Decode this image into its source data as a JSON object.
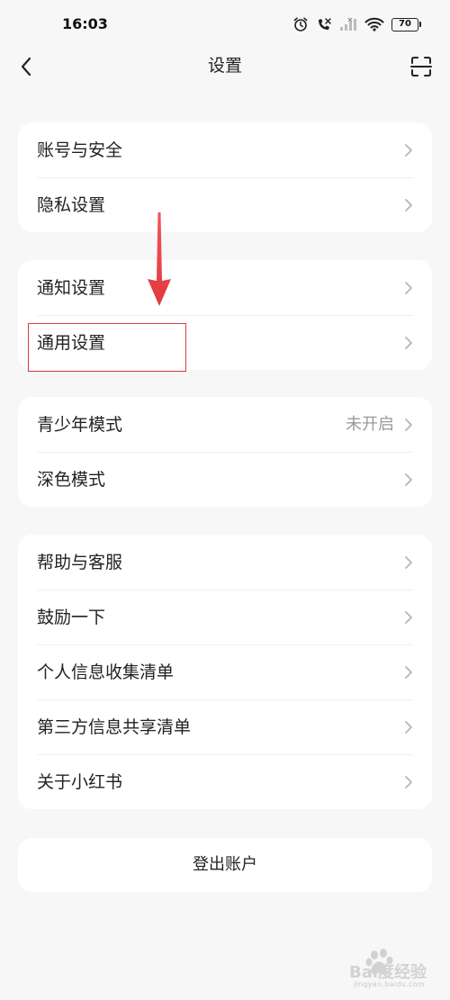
{
  "status_bar": {
    "time": "16:03",
    "battery": "70"
  },
  "header": {
    "title": "设置"
  },
  "groups": [
    {
      "items": [
        {
          "label": "账号与安全",
          "value": ""
        },
        {
          "label": "隐私设置",
          "value": ""
        }
      ]
    },
    {
      "items": [
        {
          "label": "通知设置",
          "value": ""
        },
        {
          "label": "通用设置",
          "value": ""
        }
      ]
    },
    {
      "items": [
        {
          "label": "青少年模式",
          "value": "未开启"
        },
        {
          "label": "深色模式",
          "value": ""
        }
      ]
    },
    {
      "items": [
        {
          "label": "帮助与客服",
          "value": ""
        },
        {
          "label": "鼓励一下",
          "value": ""
        },
        {
          "label": "个人信息收集清单",
          "value": ""
        },
        {
          "label": "第三方信息共享清单",
          "value": ""
        },
        {
          "label": "关于小红书",
          "value": ""
        }
      ]
    }
  ],
  "logout": {
    "label": "登出账户"
  },
  "watermark": {
    "brand": "Bai度经验",
    "site": "jingyan.baidu.com"
  },
  "colors": {
    "background": "#f7f7f7",
    "card": "#ffffff",
    "annotation_red": "#e0393e",
    "secondary_text": "#9a9a9a"
  }
}
